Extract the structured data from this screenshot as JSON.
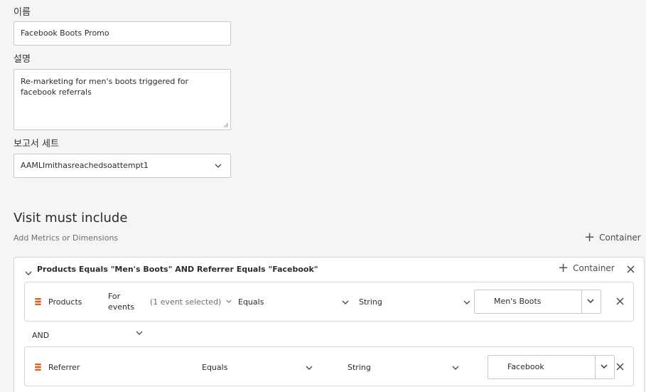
{
  "form": {
    "name_label": "이름",
    "name_value": "Facebook Boots Promo",
    "description_label": "설명",
    "description_value": "Re-marketing for men's boots triggered for facebook referrals",
    "report_suite_label": "보고서 세트",
    "report_suite_value": "AAMLImithasreachedsoattempt1"
  },
  "definition": {
    "title": "Visit must include",
    "hint": "Add Metrics or Dimensions",
    "add_container_label": "Container"
  },
  "container": {
    "title": "Products Equals \"Men's Boots\" AND Referrer Equals \"Facebook\"",
    "add_container_label": "Container",
    "rules": [
      {
        "dimension": "Products",
        "for_events_label": "For events",
        "events_value": "(1 event selected)",
        "operator": "Equals",
        "type": "String",
        "value": "Men's Boots"
      },
      {
        "dimension": "Referrer",
        "operator": "Equals",
        "type": "String",
        "value": "Facebook"
      }
    ],
    "logic_operator": "AND"
  },
  "colors": {
    "dimension_icon": "#e4611d",
    "background": "#f5f5f5"
  }
}
